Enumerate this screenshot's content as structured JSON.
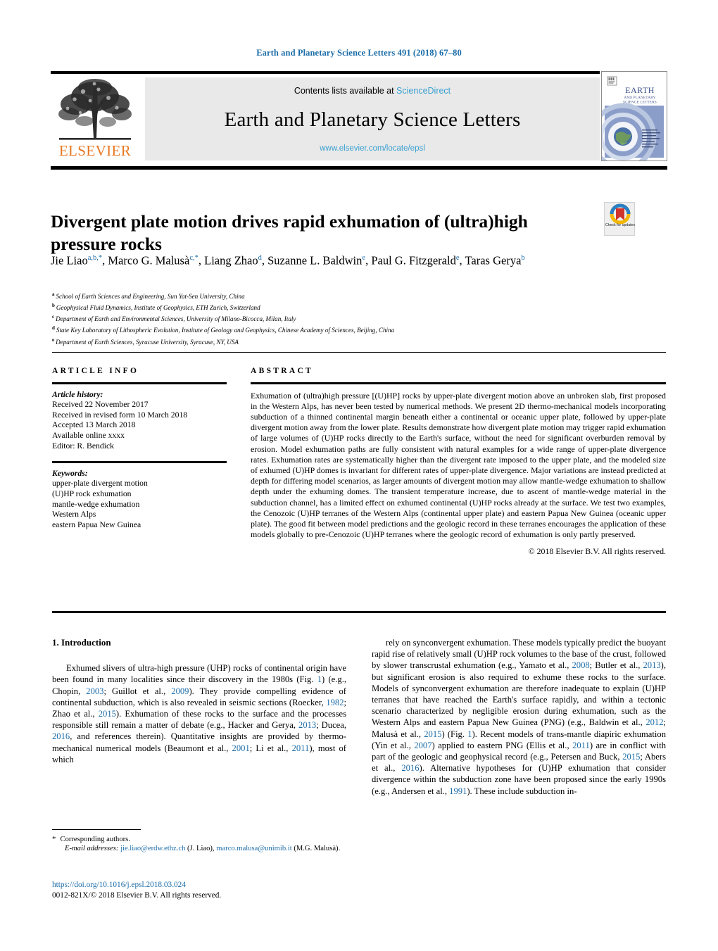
{
  "running_head": "Earth and Planetary Science Letters 491 (2018) 67–80",
  "masthead": {
    "contents_prefix": "Contents lists available at ",
    "sciencedirect": "ScienceDirect",
    "journal_title": "Earth and Planetary Science Letters",
    "journal_url": "www.elsevier.com/locate/epsl",
    "publisher": "ELSEVIER",
    "cover_title_line1": "EARTH",
    "cover_title_line2": "AND PLANETARY",
    "cover_title_line3": "SCIENCE LETTERS"
  },
  "article": {
    "title": "Divergent plate motion drives rapid exhumation of (ultra)high pressure rocks",
    "crossmark_label": "Check for updates",
    "authors_html": "Jie Liao<sup>a,b,</sup><sup>*</sup>, Marco G. Malusà<sup>c,</sup><sup>*</sup>, Liang Zhao<sup>d</sup>, Suzanne L. Baldwin<sup>e</sup>, Paul G. Fitzgerald<sup>e</sup>, Taras Gerya<sup>b</sup>",
    "affiliations": [
      {
        "letter": "a",
        "text": "School of Earth Sciences and Engineering, Sun Yat-Sen University, China"
      },
      {
        "letter": "b",
        "text": "Geophysical Fluid Dynamics, Institute of Geophysics, ETH Zurich, Switzerland"
      },
      {
        "letter": "c",
        "text": "Department of Earth and Environmental Sciences, University of Milano-Bicocca, Milan, Italy"
      },
      {
        "letter": "d",
        "text": "State Key Laboratory of Lithospheric Evolution, Institute of Geology and Geophysics, Chinese Academy of Sciences, Beijing, China"
      },
      {
        "letter": "e",
        "text": "Department of Earth Sciences, Syracuse University, Syracuse, NY, USA"
      }
    ]
  },
  "info": {
    "heading": "ARTICLE INFO",
    "history_label": "Article history:",
    "history": [
      "Received 22 November 2017",
      "Received in revised form 10 March 2018",
      "Accepted 13 March 2018",
      "Available online xxxx",
      "Editor: R. Bendick"
    ],
    "keywords_label": "Keywords:",
    "keywords": [
      "upper-plate divergent motion",
      "(U)HP rock exhumation",
      "mantle-wedge exhumation",
      "Western Alps",
      "eastern Papua New Guinea"
    ]
  },
  "abstract": {
    "heading": "ABSTRACT",
    "text": "Exhumation of (ultra)high pressure [(U)HP] rocks by upper-plate divergent motion above an unbroken slab, first proposed in the Western Alps, has never been tested by numerical methods. We present 2D thermo-mechanical models incorporating subduction of a thinned continental margin beneath either a continental or oceanic upper plate, followed by upper-plate divergent motion away from the lower plate. Results demonstrate how divergent plate motion may trigger rapid exhumation of large volumes of (U)HP rocks directly to the Earth's surface, without the need for significant overburden removal by erosion. Model exhumation paths are fully consistent with natural examples for a wide range of upper-plate divergence rates. Exhumation rates are systematically higher than the divergent rate imposed to the upper plate, and the modeled size of exhumed (U)HP domes is invariant for different rates of upper-plate divergence. Major variations are instead predicted at depth for differing model scenarios, as larger amounts of divergent motion may allow mantle-wedge exhumation to shallow depth under the exhuming domes. The transient temperature increase, due to ascent of mantle-wedge material in the subduction channel, has a limited effect on exhumed continental (U)HP rocks already at the surface. We test two examples, the Cenozoic (U)HP terranes of the Western Alps (continental upper plate) and eastern Papua New Guinea (oceanic upper plate). The good fit between model predictions and the geologic record in these terranes encourages the application of these models globally to pre-Cenozoic (U)HP terranes where the geologic record of exhumation is only partly preserved.",
    "copyright": "© 2018 Elsevier B.V. All rights reserved."
  },
  "body": {
    "section_heading": "1. Introduction",
    "left_paragraph_html": "Exhumed slivers of ultra-high pressure (UHP) rocks of continental origin have been found in many localities since their discovery in the 1980s (Fig. <span class=\"lnk\">1</span>) (e.g., Chopin, <span class=\"lnk\">2003</span>; Guillot et al., <span class=\"lnk\">2009</span>). They provide compelling evidence of continental subduction, which is also revealed in seismic sections (Roecker, <span class=\"lnk\">1982</span>; Zhao et al., <span class=\"lnk\">2015</span>). Exhumation of these rocks to the surface and the processes responsible still remain a matter of debate (e.g., Hacker and Gerya, <span class=\"lnk\">2013</span>; Ducea, <span class=\"lnk\">2016</span>, and references therein). Quantitative insights are provided by thermo-mechanical numerical models (Beaumont et al., <span class=\"lnk\">2001</span>; Li et al., <span class=\"lnk\">2011</span>), most of which",
    "right_paragraph_html": "rely on synconvergent exhumation. These models typically predict the buoyant rapid rise of relatively small (U)HP rock volumes to the base of the crust, followed by slower transcrustal exhumation (e.g., Yamato et al., <span class=\"lnk\">2008</span>; Butler et al., <span class=\"lnk\">2013</span>), but significant erosion is also required to exhume these rocks to the surface. Models of synconvergent exhumation are therefore inadequate to explain (U)HP terranes that have reached the Earth's surface rapidly, and within a tectonic scenario characterized by negligible erosion during exhumation, such as the Western Alps and eastern Papua New Guinea (PNG) (e.g., Baldwin et al., <span class=\"lnk\">2012</span>; Malusà et al., <span class=\"lnk\">2015</span>) (Fig. <span class=\"lnk\">1</span>). Recent models of trans-mantle diapiric exhumation (Yin et al., <span class=\"lnk\">2007</span>) applied to eastern PNG (Ellis et al., <span class=\"lnk\">2011</span>) are in conflict with part of the geologic and geophysical record (e.g., Petersen and Buck, <span class=\"lnk\">2015</span>; Abers et al., <span class=\"lnk\">2016</span>). Alternative hypotheses for (U)HP exhumation that consider divergence within the subduction zone have been proposed since the early 1990s (e.g., Andersen et al., <span class=\"lnk\">1991</span>). These include subduction in-"
  },
  "footnote": {
    "star": "*",
    "corresponding": "Corresponding authors.",
    "email_label": "E-mail addresses:",
    "email1": "jie.liao@erdw.ethz.ch",
    "email1_owner": "(J. Liao),",
    "email2": "marco.malusa@unimib.it",
    "email2_owner": "(M.G. Malusà)."
  },
  "doi": {
    "link": "https://doi.org/10.1016/j.epsl.2018.03.024",
    "issn_line": "0012-821X/© 2018 Elsevier B.V. All rights reserved."
  },
  "colors": {
    "link_blue": "#1b6ca8",
    "light_blue": "#3aa0d1",
    "elsevier_orange": "#E87722",
    "masthead_grey": "#e9e9e9"
  }
}
